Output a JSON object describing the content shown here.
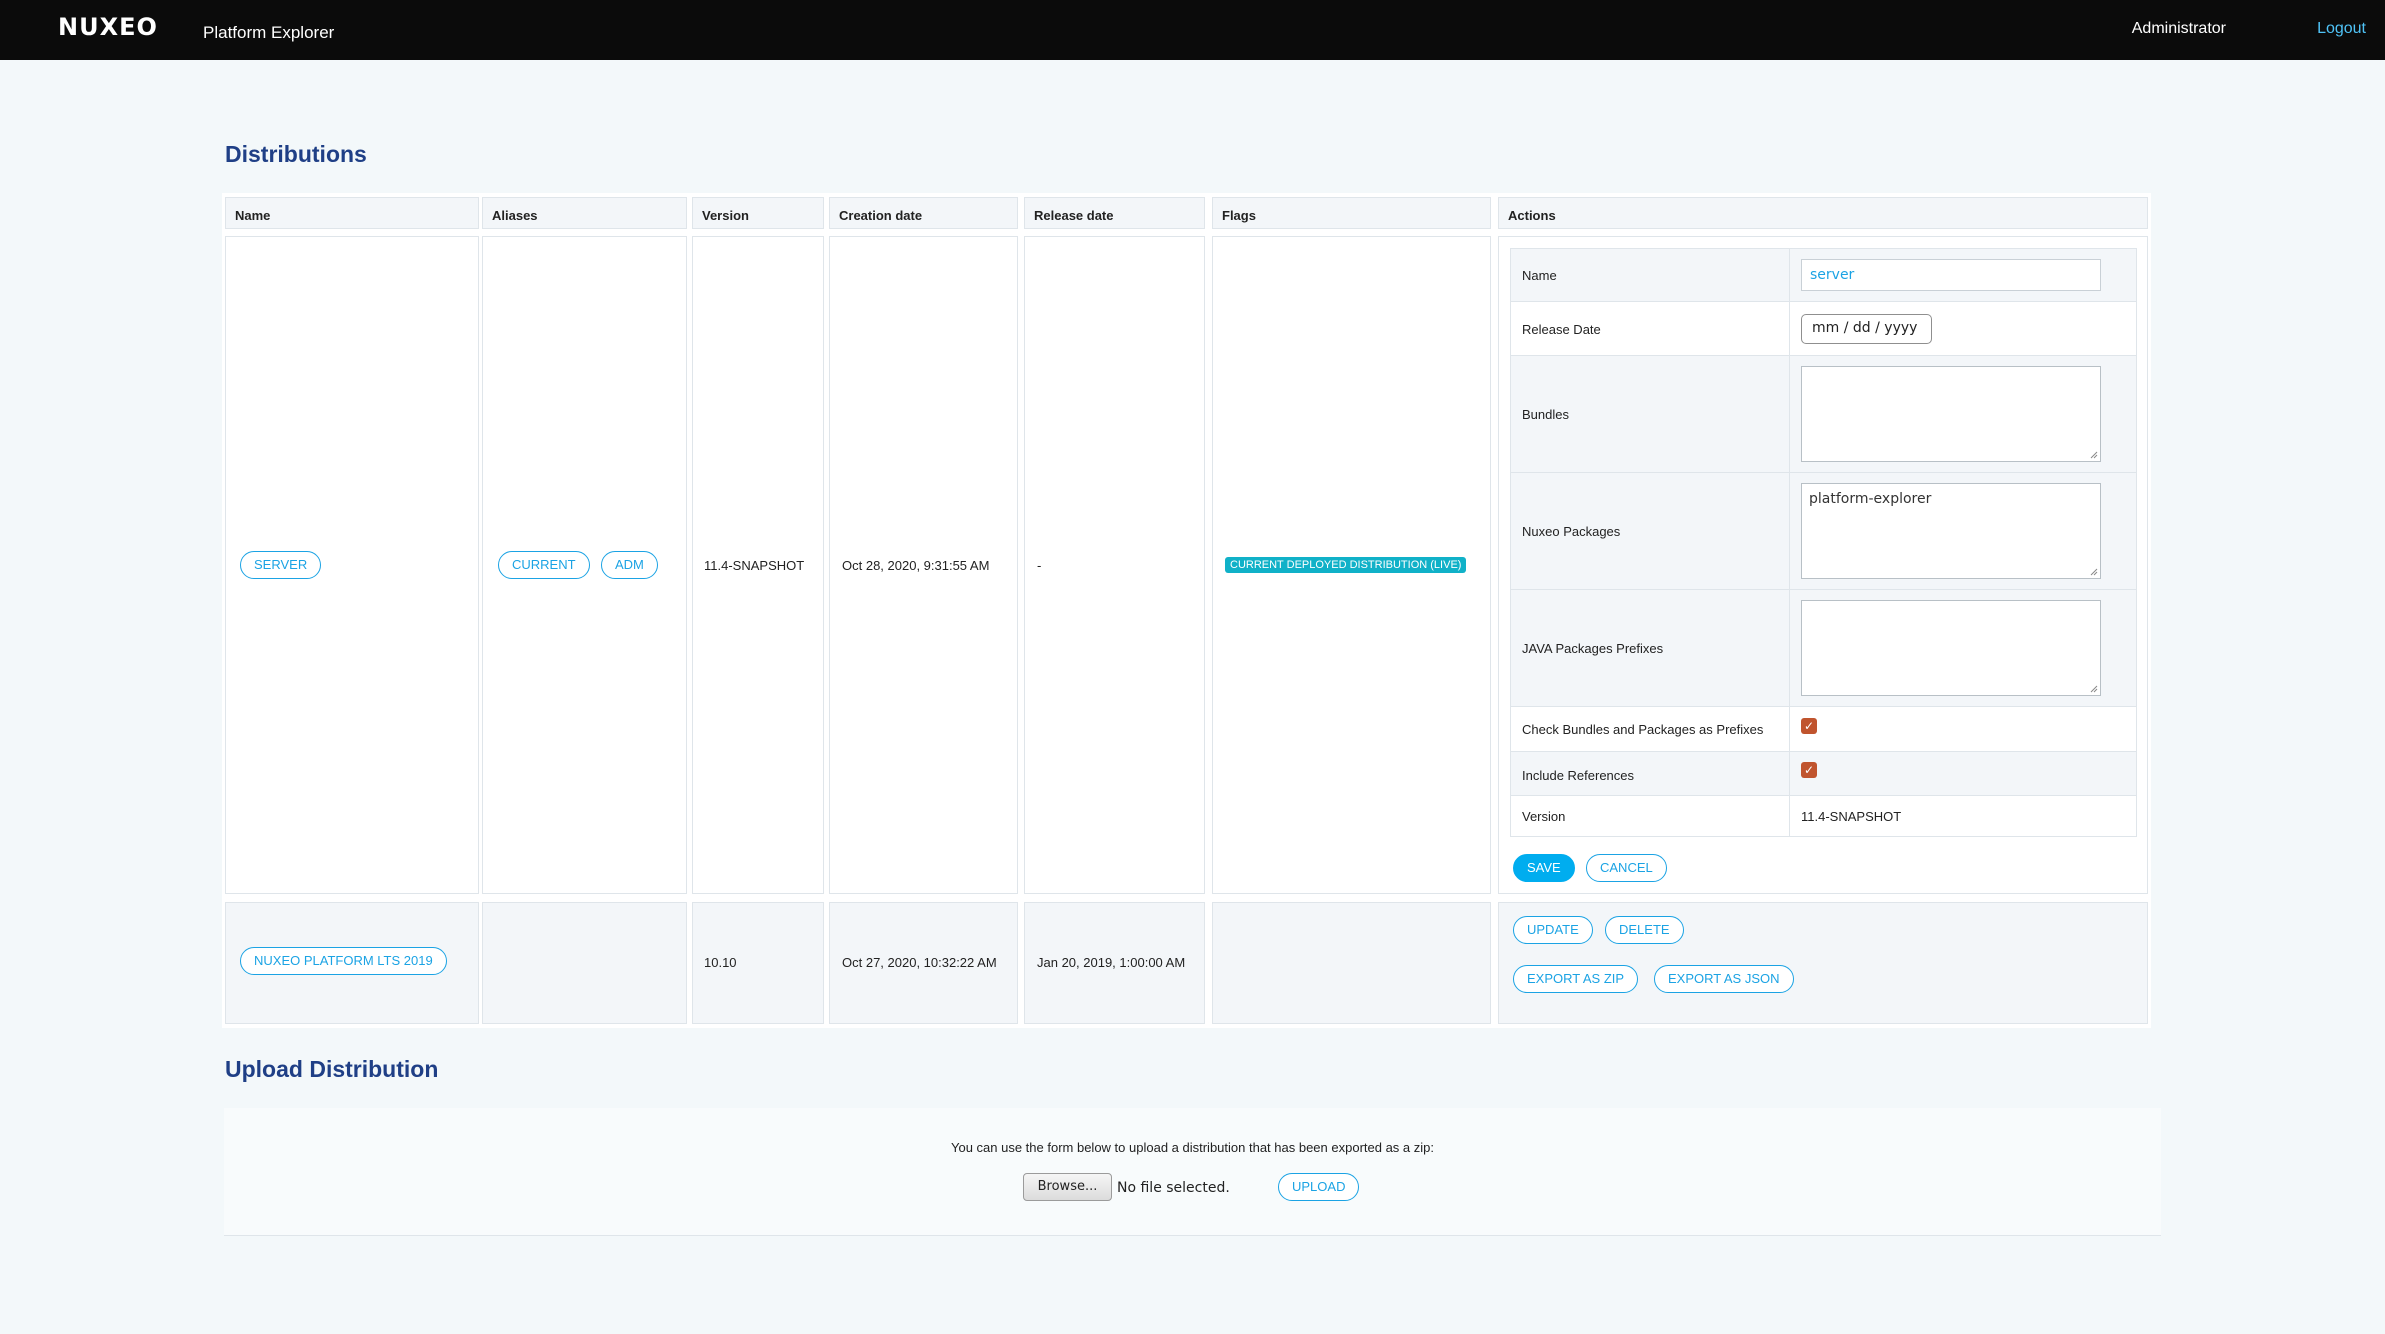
{
  "header": {
    "logo_text": "NUXEO",
    "app_title": "Platform Explorer",
    "user": "Administrator",
    "logout": "Logout"
  },
  "distributions": {
    "title": "Distributions",
    "columns": [
      "Name",
      "Aliases",
      "Version",
      "Creation date",
      "Release date",
      "Flags",
      "Actions"
    ],
    "rows": [
      {
        "name": "SERVER",
        "aliases": [
          "CURRENT",
          "ADM"
        ],
        "version": "11.4-SNAPSHOT",
        "creation_date": "Oct 28, 2020, 9:31:55 AM",
        "release_date": "-",
        "flag": "CURRENT DEPLOYED DISTRIBUTION (LIVE)"
      },
      {
        "name": "NUXEO PLATFORM LTS 2019",
        "aliases": [],
        "version": "10.10",
        "creation_date": "Oct 27, 2020, 10:32:22 AM",
        "release_date": "Jan 20, 2019, 1:00:00 AM",
        "flag": ""
      }
    ],
    "form": {
      "name_label": "Name",
      "name_value": "server",
      "release_date_label": "Release Date",
      "release_date_placeholder": "mm / dd / yyyy",
      "bundles_label": "Bundles",
      "bundles_value": "",
      "packages_label": "Nuxeo Packages",
      "packages_value": "platform-explorer",
      "java_prefixes_label": "JAVA Packages Prefixes",
      "java_prefixes_value": "",
      "check_prefixes_label": "Check Bundles and Packages as Prefixes",
      "check_prefixes_checked": true,
      "include_refs_label": "Include References",
      "include_refs_checked": true,
      "version_label": "Version",
      "version_value": "11.4-SNAPSHOT",
      "save": "SAVE",
      "cancel": "CANCEL"
    },
    "row_actions": {
      "update": "UPDATE",
      "delete": "DELETE",
      "export_zip": "EXPORT AS ZIP",
      "export_json": "EXPORT AS JSON"
    }
  },
  "upload": {
    "title": "Upload Distribution",
    "info": "You can use the form below to upload a distribution that has been exported as a zip:",
    "browse": "Browse...",
    "no_file": "No file selected.",
    "upload_button": "UPLOAD"
  },
  "colors": {
    "accent": "#1ba3e4",
    "heading": "#1f3f86",
    "flag": "#10b1c8",
    "checkbox": "#c0542e"
  }
}
